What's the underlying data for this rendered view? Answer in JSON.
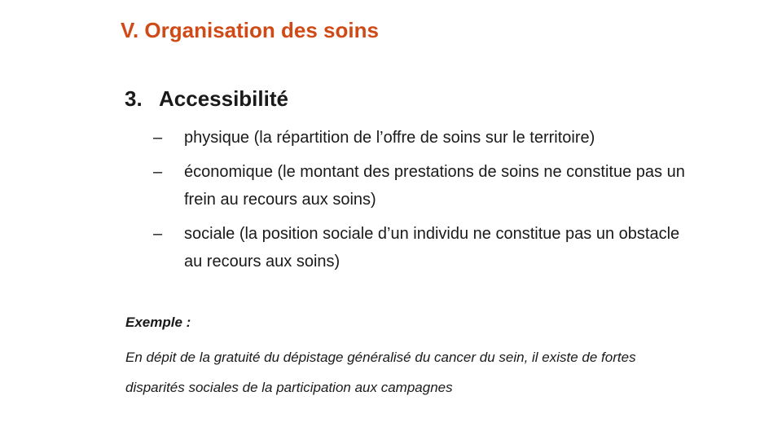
{
  "slide": {
    "title": "V. Organisation des soins",
    "title_color": "#d04a17"
  },
  "section": {
    "number": "3.",
    "heading": "Accessibilité"
  },
  "bullets": [
    {
      "dash": "–",
      "text": "physique (la répartition de l’offre de soins sur le territoire)"
    },
    {
      "dash": "–",
      "text": "économique (le montant des prestations de soins ne constitue pas un frein au recours aux soins)"
    },
    {
      "dash": "–",
      "text": "sociale (la position sociale d’un individu ne constitue pas un obstacle au recours aux soins)"
    }
  ],
  "example": {
    "label": "Exemple :",
    "text": "En dépit de la gratuité du dépistage généralisé du cancer du sein, il existe de fortes disparités sociales de la participation aux campagnes"
  }
}
